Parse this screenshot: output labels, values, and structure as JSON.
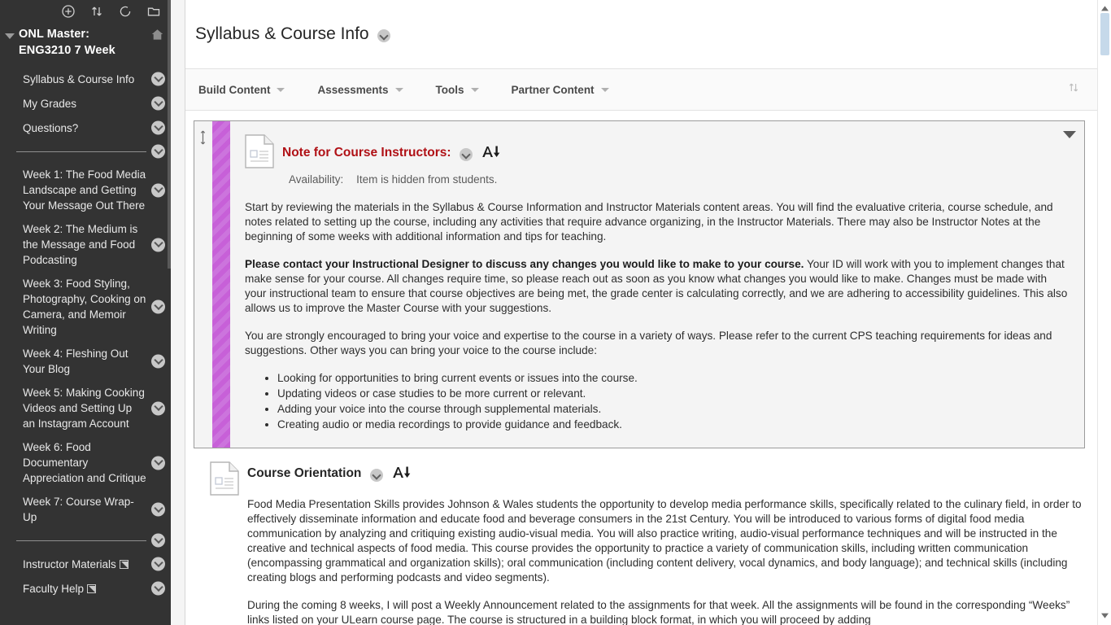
{
  "sidebar": {
    "tools": [
      {
        "name": "add-item-icon",
        "label": "Add"
      },
      {
        "name": "sort-icon",
        "label": "Sort"
      },
      {
        "name": "refresh-icon",
        "label": "Refresh"
      },
      {
        "name": "folder-icon",
        "label": "Folder View"
      }
    ],
    "course_title": "ONL Master: ENG3210 7 Week",
    "home_icon": "home-icon",
    "items": [
      {
        "label": "Syllabus & Course Info",
        "external": false
      },
      {
        "label": "My Grades",
        "external": false
      },
      {
        "label": "Questions?",
        "external": false
      },
      {
        "type": "separator"
      },
      {
        "label": "Week 1: The Food Media Landscape and Getting Your Message Out There",
        "external": false
      },
      {
        "label": "Week 2: The Medium is the Message and Food Podcasting",
        "external": false
      },
      {
        "label": "Week 3: Food Styling, Photography, Cooking on Camera, and Memoir Writing",
        "external": false
      },
      {
        "label": "Week 4: Fleshing Out Your Blog",
        "external": false
      },
      {
        "label": "Week 5: Making Cooking Videos and Setting Up an Instagram Account",
        "external": false
      },
      {
        "label": "Week 6: Food Documentary Appreciation and Critique",
        "external": false
      },
      {
        "label": "Week 7: Course Wrap-Up",
        "external": false
      },
      {
        "type": "separator"
      },
      {
        "label": "Instructor Materials",
        "external": true
      },
      {
        "label": "Faculty Help",
        "external": true
      }
    ]
  },
  "header": {
    "title": "Syllabus & Course Info"
  },
  "action_bar": {
    "items": [
      {
        "label": "Build Content"
      },
      {
        "label": "Assessments"
      },
      {
        "label": "Tools"
      },
      {
        "label": "Partner Content"
      }
    ],
    "sort_icon": "sort-icon"
  },
  "content": {
    "items": [
      {
        "title": "Note for Course Instructors:",
        "title_color": "#b01116",
        "availability_label": "Availability:",
        "availability_value": "Item is hidden from students.",
        "paragraphs": [
          {
            "type": "text",
            "runs": [
              {
                "bold": false,
                "text": "Start by reviewing the materials in the Syllabus & Course Information and Instructor Materials content areas. You will find the evaluative criteria, course schedule, and notes related to setting up the course, including any activities that require advance organizing, in the Instructor Materials. There may also be Instructor Notes at the beginning of some weeks with additional information and tips for teaching."
              }
            ]
          },
          {
            "type": "text",
            "runs": [
              {
                "bold": true,
                "text": "Please contact your Instructional Designer to discuss any changes you would like to make to your course."
              },
              {
                "bold": false,
                "text": " Your ID will work with you to implement changes that make sense for your course. All changes require time, so please reach out as soon as you know what changes you would like to make. Changes must be made with your instructional team to ensure that course objectives are being met, the grade center is calculating correctly, and we are adhering to accessibility guidelines. This also allows us to improve the Master Course with your suggestions."
              }
            ]
          },
          {
            "type": "text",
            "runs": [
              {
                "bold": false,
                "text": "You are strongly encouraged to bring your voice and expertise to the course in a variety of ways. Please refer to the current CPS teaching requirements for ideas and suggestions. Other ways you can bring your voice to the course include:"
              }
            ]
          },
          {
            "type": "list",
            "items": [
              "Looking for opportunities to bring current events or issues into the course.",
              "Updating videos or case studies to be more current or relevant.",
              "Adding your voice into the course through supplemental materials.",
              "Creating audio or media recordings to provide guidance and feedback."
            ]
          }
        ]
      },
      {
        "title": "Course Orientation",
        "title_color": "#262626",
        "paragraphs": [
          {
            "type": "text",
            "runs": [
              {
                "bold": false,
                "text": "Food Media Presentation Skills provides Johnson & Wales students the opportunity to develop media performance skills, specifically related to the culinary field, in order to effectively disseminate information and educate food and beverage consumers in the 21st Century. You will be introduced to various forms of digital food media communication by analyzing and critiquing existing audio-visual media. You will also practice writing, audio-visual performance techniques and will be instructed in the creative and technical aspects of food media. This course provides the opportunity to practice a variety of communication skills, including written communication (encompassing grammatical and organization skills); oral communication (including content delivery, vocal dynamics, and body language); and technical skills (including creating blogs and performing podcasts and video segments)."
              }
            ]
          },
          {
            "type": "text",
            "runs": [
              {
                "bold": false,
                "text": "During the coming 8 weeks, I will post a Weekly Announcement related to the assignments for that week. All the assignments will be found in the corresponding “Weeks” links listed on your ULearn course page. The course is structured in a building block format, in which you will proceed by adding"
              }
            ]
          }
        ]
      }
    ]
  },
  "colors": {
    "sidebar_bg": "#333333",
    "accent_stripe": "#c760d8",
    "title_red": "#b01116",
    "scrollbar_thumb": "#c6d9ea"
  }
}
